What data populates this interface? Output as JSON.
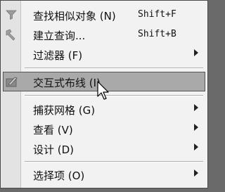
{
  "menu": {
    "items": [
      {
        "label": "查找相似对象 (N)",
        "accel": "Shift+F",
        "icon": "funnel-icon"
      },
      {
        "label": "建立查询...",
        "accel": "Shift+B",
        "icon": "query-tool-icon"
      },
      {
        "label": "过滤器 (F)",
        "submenu": true
      },
      {
        "label": "交互式布线 (I)",
        "icon": "routing-icon",
        "selected": true
      },
      {
        "label": "捕获网格 (G)",
        "submenu": true
      },
      {
        "label": "查看 (V)",
        "submenu": true
      },
      {
        "label": "设计 (D)",
        "submenu": true
      },
      {
        "label": "选择项 (O)",
        "submenu": true
      }
    ]
  },
  "colors": {
    "menu_background": "#f2f2f2",
    "icon_gutter": "#e3e3e3",
    "highlight": "#a9a9a9",
    "outside": "#6a6a6a"
  }
}
